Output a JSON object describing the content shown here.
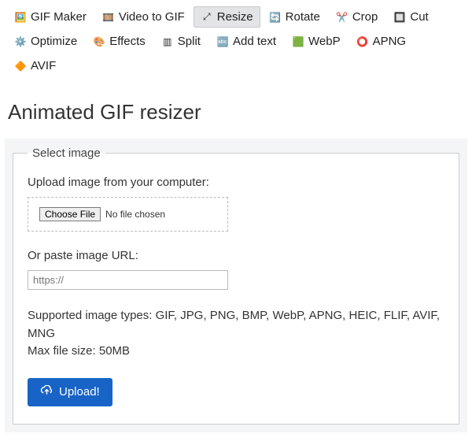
{
  "nav": [
    {
      "label": "GIF Maker",
      "icon": "🖼️",
      "icon_name": "gif-maker-icon",
      "active": false
    },
    {
      "label": "Video to GIF",
      "icon": "🎞️",
      "icon_name": "video-icon",
      "active": false
    },
    {
      "label": "Resize",
      "icon": "⤢",
      "icon_name": "resize-icon",
      "active": true
    },
    {
      "label": "Rotate",
      "icon": "🔄",
      "icon_name": "rotate-icon",
      "active": false
    },
    {
      "label": "Crop",
      "icon": "✂️",
      "icon_name": "crop-icon",
      "active": false
    },
    {
      "label": "Cut",
      "icon": "🔲",
      "icon_name": "cut-icon",
      "active": false
    },
    {
      "label": "Optimize",
      "icon": "⚙️",
      "icon_name": "optimize-icon",
      "active": false
    },
    {
      "label": "Effects",
      "icon": "🎨",
      "icon_name": "effects-icon",
      "active": false
    },
    {
      "label": "Split",
      "icon": "▥",
      "icon_name": "split-icon",
      "active": false
    },
    {
      "label": "Add text",
      "icon": "🔤",
      "icon_name": "add-text-icon",
      "active": false
    },
    {
      "label": "WebP",
      "icon": "🟩",
      "icon_name": "webp-icon",
      "active": false
    },
    {
      "label": "APNG",
      "icon": "⭕",
      "icon_name": "apng-icon",
      "active": false
    },
    {
      "label": "AVIF",
      "icon": "🔶",
      "icon_name": "avif-icon",
      "active": false
    }
  ],
  "page_title": "Animated GIF resizer",
  "form": {
    "legend": "Select image",
    "upload_label": "Upload image from your computer:",
    "choose_file_btn": "Choose File",
    "file_status": "No file chosen",
    "url_label": "Or paste image URL:",
    "url_placeholder": "https://",
    "info_types": "Supported image types: GIF, JPG, PNG, BMP, WebP, APNG, HEIC, FLIF, AVIF, MNG",
    "info_size": "Max file size: 50MB",
    "upload_btn": "Upload!"
  }
}
